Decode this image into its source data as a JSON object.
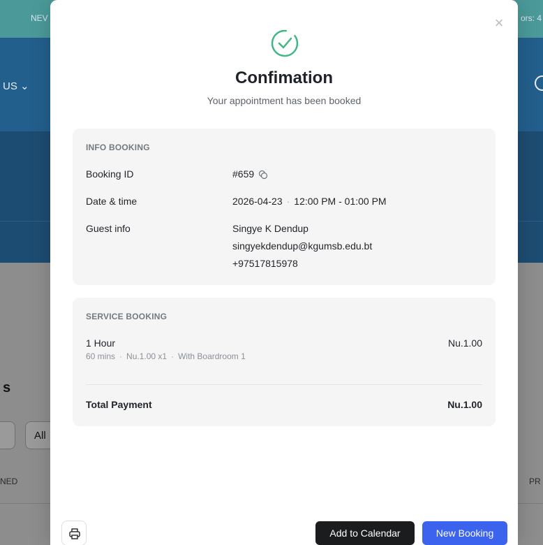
{
  "background": {
    "topbar_left": "NEV",
    "topbar_right": "ors: 4",
    "nav_menu": "US ⌄",
    "heading": "s",
    "filter_all": "All",
    "column_left": "NED",
    "column_right": "PR"
  },
  "modal": {
    "title": "Confimation",
    "subtitle": "Your appointment has been booked",
    "close_symbol": "×",
    "info": {
      "heading": "INFO BOOKING",
      "booking_id_label": "Booking ID",
      "booking_id_value": "#659",
      "datetime_label": "Date & time",
      "date": "2026-04-23",
      "time": "12:00 PM - 01:00 PM",
      "guest_label": "Guest info",
      "guest_name": "Singye K Dendup",
      "guest_email": "singyekdendup@kgumsb.edu.bt",
      "guest_phone": "+97517815978"
    },
    "service": {
      "heading": "SERVICE BOOKING",
      "name": "1 Hour",
      "duration": "60 mins",
      "unit_price": "Nu.1.00 x1",
      "resource": "With Boardroom 1",
      "price": "Nu.1.00",
      "total_label": "Total Payment",
      "total_value": "Nu.1.00"
    },
    "actions": {
      "add_to_calendar": "Add to Calendar",
      "new_booking": "New Booking"
    }
  },
  "colors": {
    "success": "#3fb886",
    "primary": "#3c63ee",
    "dark_button": "#1b1c1e"
  }
}
